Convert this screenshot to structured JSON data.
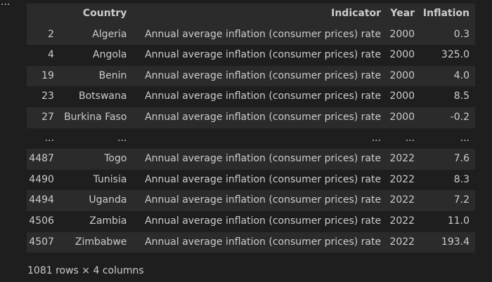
{
  "toolbar": {
    "more_label": "···"
  },
  "table": {
    "columns": [
      "",
      "Country",
      "Indicator",
      "Year",
      "Inflation"
    ],
    "rows": [
      [
        "2",
        "Algeria",
        "Annual average inflation (consumer prices) rate",
        "2000",
        "0.3"
      ],
      [
        "4",
        "Angola",
        "Annual average inflation (consumer prices) rate",
        "2000",
        "325.0"
      ],
      [
        "19",
        "Benin",
        "Annual average inflation (consumer prices) rate",
        "2000",
        "4.0"
      ],
      [
        "23",
        "Botswana",
        "Annual average inflation (consumer prices) rate",
        "2000",
        "8.5"
      ],
      [
        "27",
        "Burkina Faso",
        "Annual average inflation (consumer prices) rate",
        "2000",
        "-0.2"
      ],
      [
        "...",
        "...",
        "...",
        "...",
        "..."
      ],
      [
        "4487",
        "Togo",
        "Annual average inflation (consumer prices) rate",
        "2022",
        "7.6"
      ],
      [
        "4490",
        "Tunisia",
        "Annual average inflation (consumer prices) rate",
        "2022",
        "8.3"
      ],
      [
        "4494",
        "Uganda",
        "Annual average inflation (consumer prices) rate",
        "2022",
        "7.2"
      ],
      [
        "4506",
        "Zambia",
        "Annual average inflation (consumer prices) rate",
        "2022",
        "11.0"
      ],
      [
        "4507",
        "Zimbabwe",
        "Annual average inflation (consumer prices) rate",
        "2022",
        "193.4"
      ]
    ]
  },
  "footer": {
    "summary": "1081 rows × 4 columns"
  }
}
